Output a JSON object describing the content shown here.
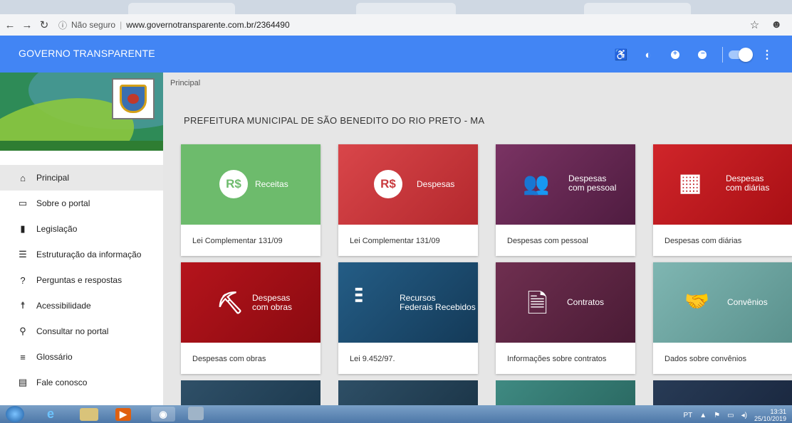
{
  "browser": {
    "url_prefix": "Não seguro",
    "url_host": "www.governotransparente.com.br/2364490"
  },
  "app": {
    "title": "GOVERNO TRANSPARENTE"
  },
  "sidebar": {
    "items": [
      {
        "label": "Principal",
        "icon": "home-icon"
      },
      {
        "label": "Sobre o portal",
        "icon": "folder-icon"
      },
      {
        "label": "Legislação",
        "icon": "file-icon"
      },
      {
        "label": "Estruturação da informação",
        "icon": "list-alt-icon"
      },
      {
        "label": "Perguntas e respostas",
        "icon": "question-icon"
      },
      {
        "label": "Acessibilidade",
        "icon": "accessibility-icon"
      },
      {
        "label": "Consultar no portal",
        "icon": "search-icon"
      },
      {
        "label": "Glossário",
        "icon": "list-icon"
      },
      {
        "label": "Fale conosco",
        "icon": "message-icon"
      }
    ]
  },
  "main": {
    "breadcrumb": "Principal",
    "title": "PREFEITURA MUNICIPAL DE SÃO BENEDITO DO RIO PRETO - MA",
    "cards": [
      {
        "label1": "Receitas",
        "label2": "",
        "desc": "Lei Complementar 131/09",
        "color": "#6dbb6c",
        "symbol": "R$"
      },
      {
        "label1": "Despesas",
        "label2": "",
        "desc": "Lei Complementar 131/09",
        "color": "#c93b3f",
        "symbol": "R$"
      },
      {
        "label1": "Despesas",
        "label2": "com pessoal",
        "desc": "Despesas com pessoal",
        "color": "#6b2a55",
        "symbol": "people"
      },
      {
        "label1": "Despesas",
        "label2": "com diárias",
        "desc": "Despesas com diárias",
        "color": "#c0171b",
        "symbol": "calendar"
      },
      {
        "label1": "Despesas",
        "label2": "com obras",
        "desc": "Despesas com obras",
        "color": "#a8121a",
        "symbol": "worker"
      },
      {
        "label1": "Recursos",
        "label2": "Federais Recebidos",
        "desc": "Lei 9.452/97.",
        "color": "#1d4f73",
        "symbol": "money"
      },
      {
        "label1": "Contratos",
        "label2": "",
        "desc": "Informações sobre contratos",
        "color": "#612845",
        "symbol": "document"
      },
      {
        "label1": "Convênios",
        "label2": "",
        "desc": "Dados sobre convênios",
        "color": "#6fa7a3",
        "symbol": "handshake"
      }
    ]
  },
  "taskbar": {
    "lang": "PT",
    "time": "13:31",
    "date": "25/10/2019"
  }
}
